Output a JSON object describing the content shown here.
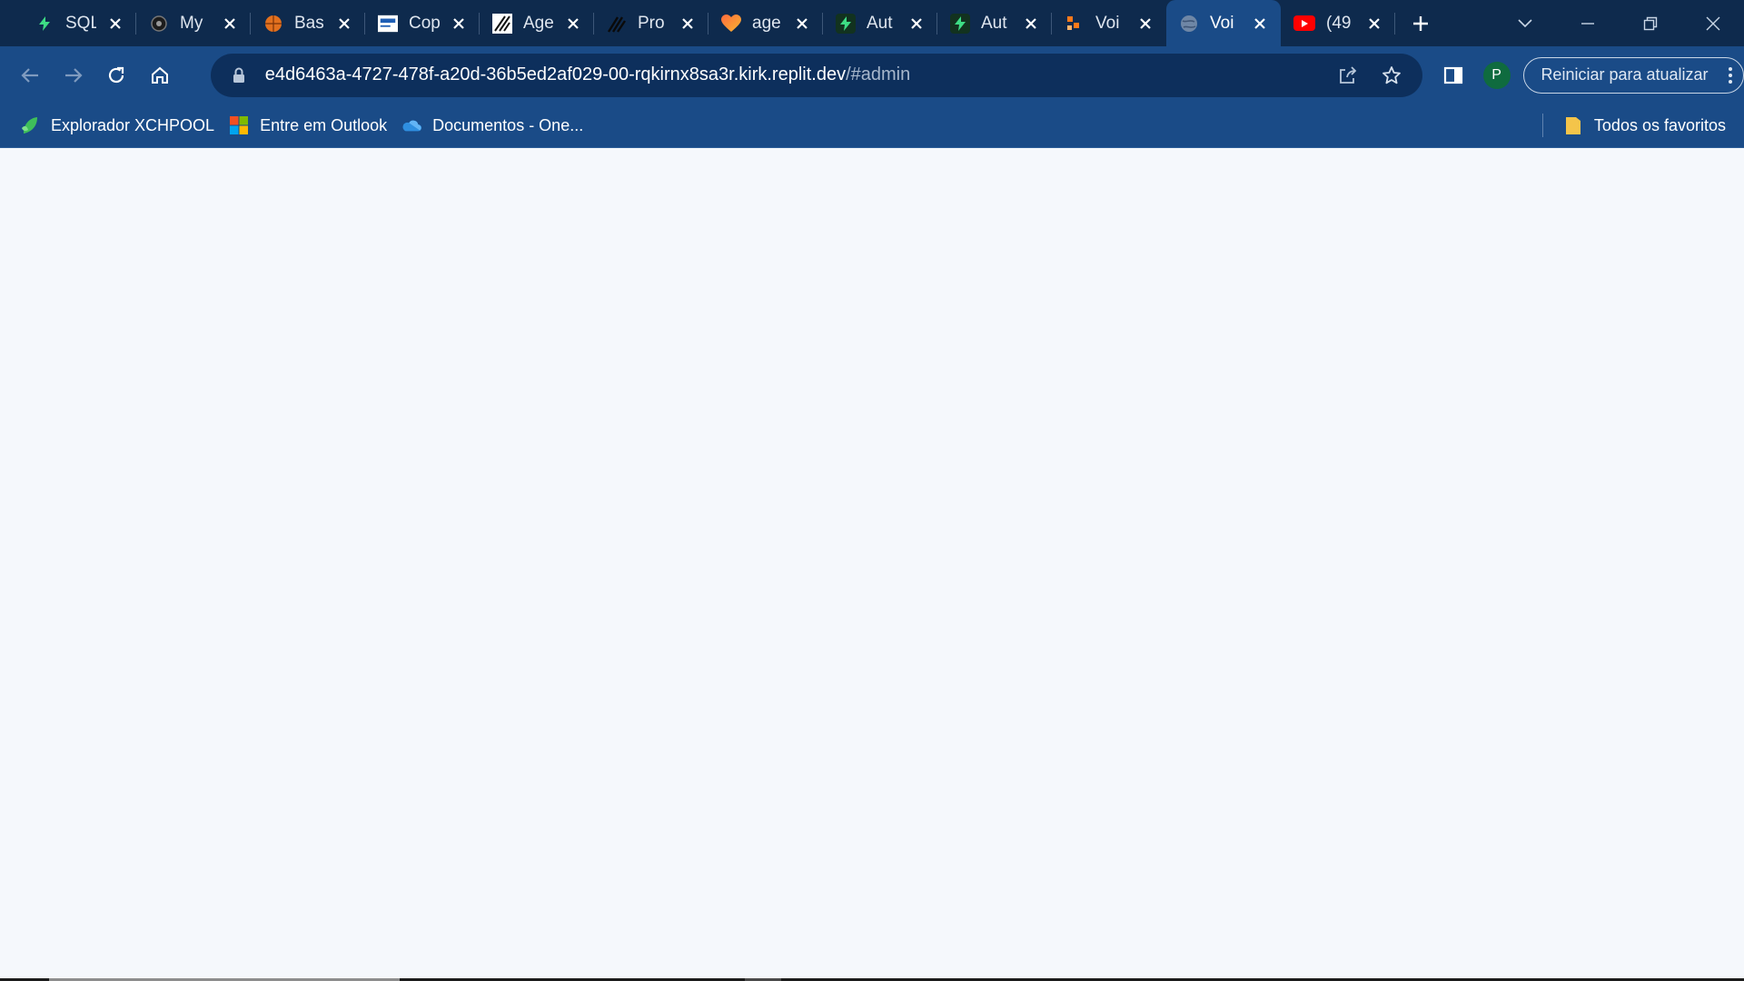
{
  "tabs": [
    {
      "title": "SQL",
      "favicon": "replit-bolt-icon",
      "favicon_bg": "#1f2a1f",
      "active": false
    },
    {
      "title": "My",
      "favicon": "gear-dark-icon",
      "favicon_bg": "#2a2a2a",
      "active": false
    },
    {
      "title": "Bas",
      "favicon": "basketball-icon",
      "favicon_bg": "#e2701e",
      "active": false
    },
    {
      "title": "Cop",
      "favicon": "document-blue-icon",
      "favicon_bg": "#ffffff",
      "active": false
    },
    {
      "title": "Age",
      "favicon": "stripes-icon",
      "favicon_bg": "#ffffff",
      "active": false
    },
    {
      "title": "Pro",
      "favicon": "stripes-dark-icon",
      "favicon_bg": "#0e2a4d",
      "active": false
    },
    {
      "title": "age",
      "favicon": "heart-icon",
      "favicon_bg": "#0e2a4d",
      "active": false
    },
    {
      "title": "Aut",
      "favicon": "replit-bolt-icon",
      "favicon_bg": "#1f2a1f",
      "active": false
    },
    {
      "title": "Aut",
      "favicon": "replit-bolt-icon",
      "favicon_bg": "#1f2a1f",
      "active": false
    },
    {
      "title": "Voi",
      "favicon": "blocks-orange-icon",
      "favicon_bg": "#0e2a4d",
      "active": false
    },
    {
      "title": "Voi",
      "favicon": "globe-icon",
      "favicon_bg": "#1a4b87",
      "active": true
    },
    {
      "title": "(49",
      "favicon": "youtube-icon",
      "favicon_bg": "#ff0000",
      "active": false
    }
  ],
  "toolbar": {
    "url_host": "e4d6463a-4727-478f-a20d-36b5ed2af029-00-rqkirnx8sa3r.kirk.replit.dev",
    "url_path": "/#admin",
    "update_label": "Reiniciar para atualizar",
    "avatar_letter": "P"
  },
  "bookmarks": {
    "items": [
      {
        "label": "Explorador XCHPOOL",
        "icon": "leaf-icon"
      },
      {
        "label": "Entre em Outlook",
        "icon": "microsoft-icon"
      },
      {
        "label": "Documentos - One...",
        "icon": "onedrive-icon"
      }
    ],
    "all_label": "Todos os favoritos"
  },
  "colors": {
    "tabstrip": "#0e2a4d",
    "toolbar": "#1a4b87",
    "omnibox": "#0d2f5c",
    "page_bg": "#f5f8fc"
  }
}
